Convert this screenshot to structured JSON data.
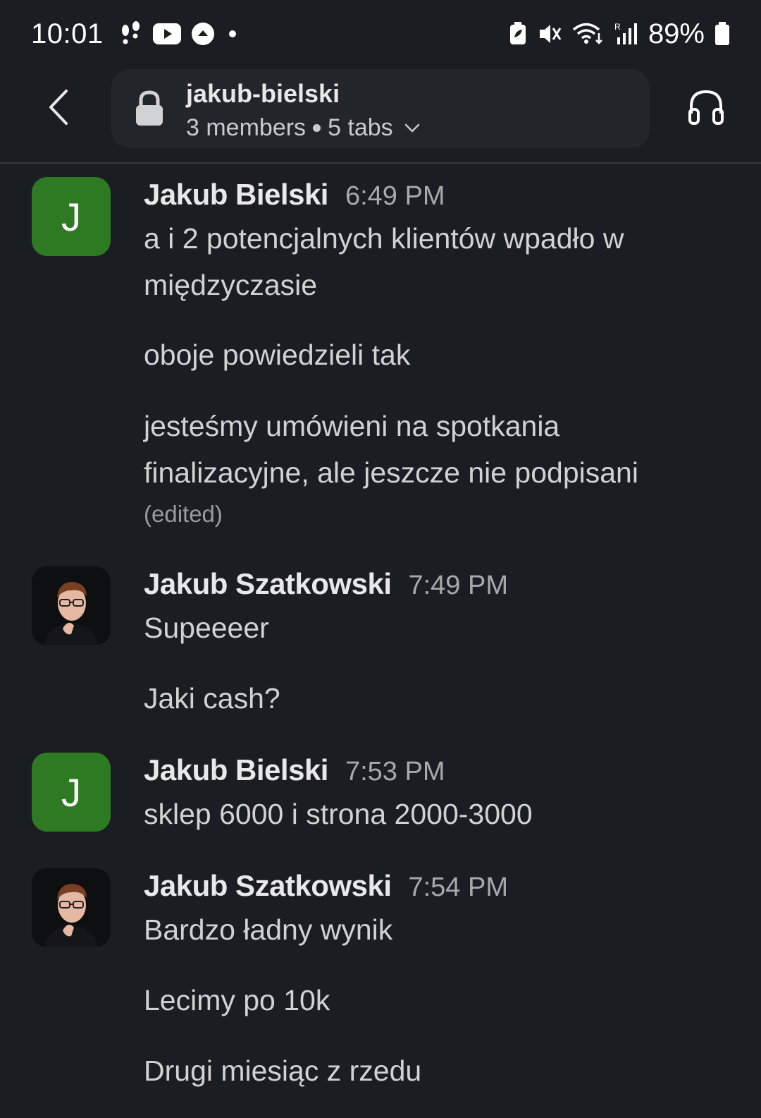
{
  "status_bar": {
    "time": "10:01",
    "battery": "89%",
    "left_icons": [
      "steps-icon",
      "youtube-icon",
      "upload-icon",
      "dot-icon"
    ],
    "right_icons": [
      "battery-saver-icon",
      "mute-vibrate-icon",
      "wifi-icon",
      "signal-icon",
      "battery-icon"
    ]
  },
  "header": {
    "channel_name": "jakub-bielski",
    "members": "3 members",
    "tabs": "5 tabs"
  },
  "messages": [
    {
      "sender": "Jakub Bielski",
      "time": "6:49 PM",
      "avatar_letter": "J",
      "avatar_color": "#2e7a23",
      "lines": [
        "a i 2 potencjalnych klientów wpadło w",
        "międzyczasie",
        "oboje powiedzieli tak",
        "jesteśmy umówieni na spotkania",
        "finalizacyjne, ale jeszcze nie podpisani"
      ],
      "edited": "(edited)"
    },
    {
      "sender": "Jakub Szatkowski",
      "time": "7:49 PM",
      "lines": [
        "Supeeeer",
        "Jaki cash?"
      ]
    },
    {
      "sender": "Jakub Bielski",
      "time": "7:53 PM",
      "avatar_letter": "J",
      "lines": [
        "sklep 6000 i strona 2000-3000"
      ]
    },
    {
      "sender": "Jakub Szatkowski",
      "time": "7:54 PM",
      "lines": [
        "Bardzo ładny wynik",
        "Lecimy po 10k",
        "Drugi miesiąc z rzedu"
      ]
    }
  ]
}
